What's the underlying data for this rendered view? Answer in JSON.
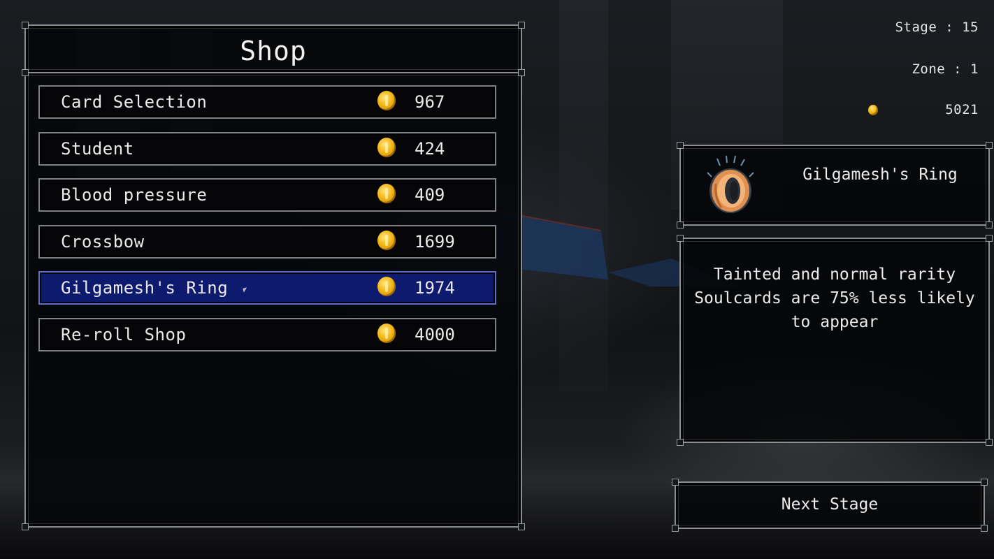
{
  "hud": {
    "stage": "Stage : 15",
    "zone": "Zone : 1",
    "gold": "5021",
    "gold_icon": "gold-coin-icon"
  },
  "shop": {
    "title": "Shop",
    "items": [
      {
        "name": "Card Selection",
        "price": "967"
      },
      {
        "name": "Student",
        "price": "424"
      },
      {
        "name": "Blood pressure",
        "price": "409"
      },
      {
        "name": "Crossbow",
        "price": "1699"
      },
      {
        "name": "Gilgamesh's Ring",
        "price": "1974",
        "selected": true
      },
      {
        "name": "Re-roll Shop",
        "price": "4000"
      }
    ]
  },
  "detail": {
    "name": "Gilgamesh's Ring",
    "icon": "ring-icon",
    "description": "Tainted and normal rarity Soulcards are 75% less likely to appear"
  },
  "actions": {
    "next_stage": "Next Stage"
  },
  "colors": {
    "selected_row": "#0d1a6e",
    "coin": "#f2b515",
    "frame": "#8b8e92"
  }
}
